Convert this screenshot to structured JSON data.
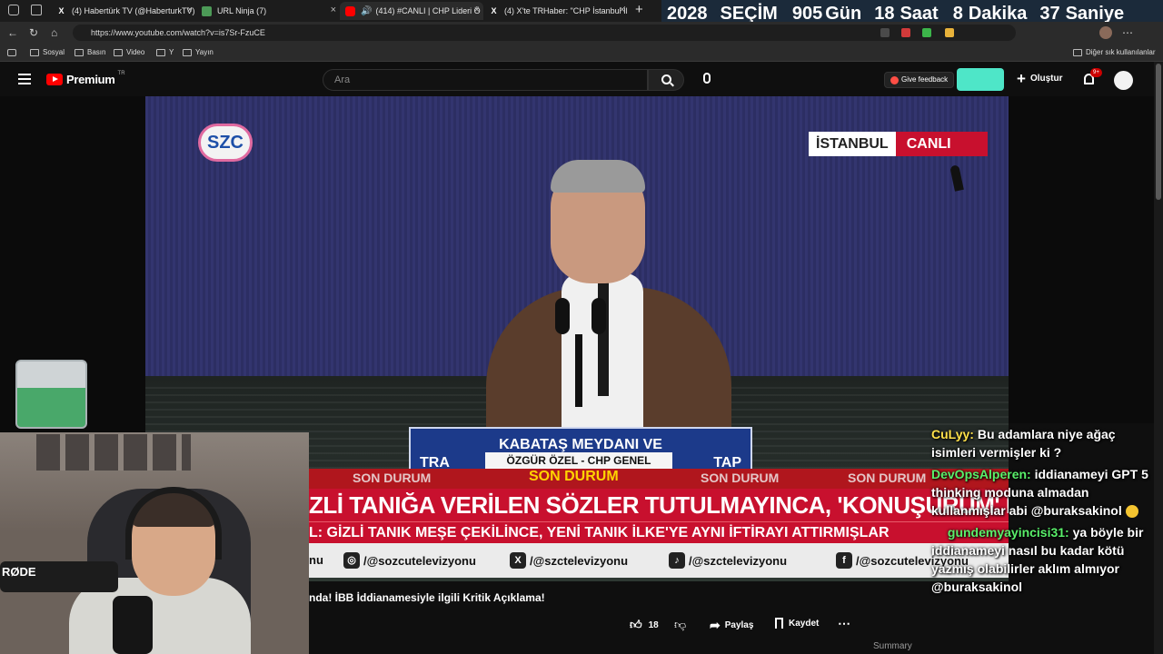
{
  "browser": {
    "tabs": [
      {
        "label": "(4) Habertürk TV (@HaberturkTV)",
        "icon": "x-logo-icon"
      },
      {
        "label": "URL Ninja (7)",
        "icon": "url-ninja-icon"
      },
      {
        "label": "(414) #CANLI | CHP Lideri Ö",
        "icon": "youtube-icon"
      },
      {
        "label": "(4) X'te TRHaber: \"CHP İstanbul İl",
        "icon": "x-logo-icon"
      }
    ],
    "url": "https://www.youtube.com/watch?v=is7Sr-FzuCE",
    "bookmarks": [
      "Sosyal",
      "Basın",
      "Video",
      "Y",
      "Yayın"
    ],
    "other_bookmarks": "Diğer sık kullanılanlar"
  },
  "countdown": {
    "year": "2028",
    "label": "SEÇİM",
    "days": "905",
    "days_label": "Gün",
    "hours": "18",
    "hours_label": "Saat",
    "minutes": "8",
    "minutes_label": "Dakika",
    "seconds": "37",
    "seconds_label": "Saniye"
  },
  "youtube": {
    "logo": "Premium",
    "region": "TR",
    "search_placeholder": "Ara",
    "feedback": "Give feedback",
    "create": "Oluştur",
    "notif_badge": "9+",
    "like_count": "18",
    "share": "Paylaş",
    "save": "Kaydet",
    "video_title": "nda! İBB İddianamesiyle ilgili Kritik Açıklama!",
    "summary": "Summary"
  },
  "broadcast": {
    "channel_logo": "SZC",
    "location": "İSTANBUL",
    "live": "CANLI",
    "podium_line1": "KABATAŞ MEYDANI VE",
    "podium_line2_left": "TRA",
    "podium_line2_right": "TAP",
    "speaker": "ÖZGÜR ÖZEL - CHP GENEL BAŞKANI",
    "son_durum": "SON DURUM",
    "headline": "ZLİ TANIĞA VERİLEN SÖZLER TUTULMAYINCA, 'KONUŞURUM' DEMİŞ\"",
    "subline": "L: GİZLİ TANIK MEŞE ÇEKİLİNCE, YENİ TANIK İLKE'YE AYNI İFTİRAYI ATTIRMIŞLAR",
    "social": [
      "/@sozcutelevizyonu",
      "/@szctelevizyonu",
      "/@szctelevizyonu",
      "/@sozcutelevizyonu"
    ],
    "social_left": "nu"
  },
  "webcam": {
    "mic_brand": "RØDE"
  },
  "chat": [
    {
      "user": "CuLyy:",
      "text": "Bu adamlara niye ağaç isimleri vermişler ki ?"
    },
    {
      "user": "DevOpsAlperen:",
      "text": "iddianameyi GPT 5 thinking moduna almadan kullanmışlar abi @buraksakinol"
    },
    {
      "user": "gundemyayincisi31:",
      "text": "ya böyle bir iddianameyi nasıl bu kadar kötü yazmış olabilirler aklım almıyor @buraksakinol"
    }
  ],
  "colors": {
    "ticker_red": "#c8102e",
    "youtube_red": "#ff0000",
    "chat_yellow": "#ffe14a",
    "chat_green": "#59f06a"
  }
}
